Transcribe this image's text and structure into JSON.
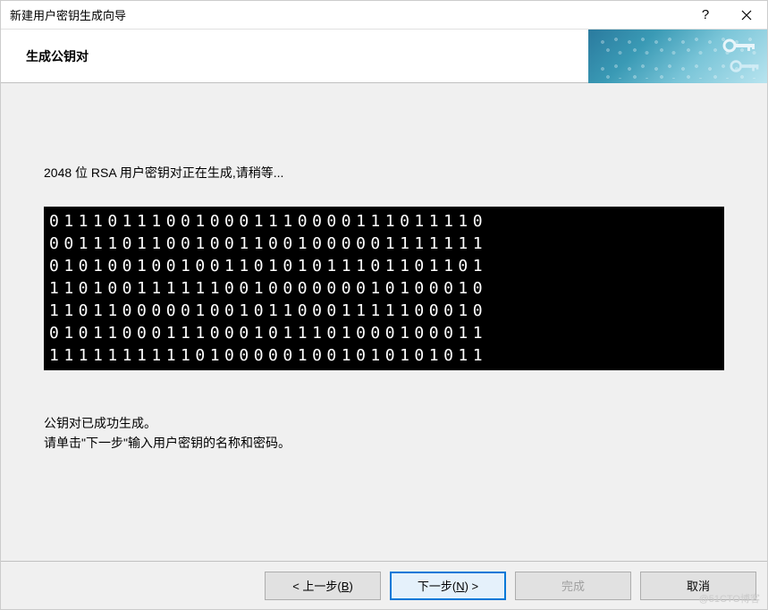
{
  "titlebar": {
    "title": "新建用户密钥生成向导"
  },
  "header": {
    "title": "生成公钥对"
  },
  "content": {
    "generating_text": "2048 位 RSA 用户密钥对正在生成,请稍等...",
    "binary_lines": [
      "011101110010001110000111011110",
      "001110110010011001000001111111",
      "010100100100110101011101101101",
      "110100111111001000000010100010",
      "110110000010010110001111100010",
      "010110001110001011101000100011",
      "111111111101000001001010101011"
    ],
    "success_text": "公钥对已成功生成。",
    "instruction_text": "请单击\"下一步\"输入用户密钥的名称和密码。"
  },
  "buttons": {
    "back_prefix": "< 上一步(",
    "back_key": "B",
    "back_suffix": ")",
    "next_prefix": "下一步(",
    "next_key": "N",
    "next_suffix": ") >",
    "finish": "完成",
    "cancel": "取消"
  },
  "watermark": "@51CTO博客"
}
